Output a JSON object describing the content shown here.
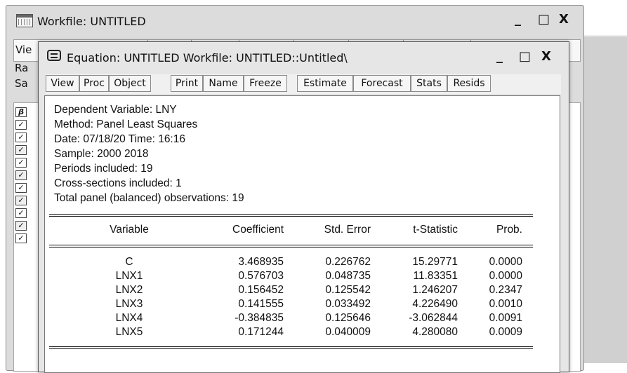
{
  "workfile": {
    "title": "Workfile: UNTITLED",
    "toolbar_partial": "Vie",
    "info_rows": [
      "Ra",
      "Sa"
    ],
    "controls": {
      "minimize": "_",
      "maximize": "□",
      "close": "X"
    }
  },
  "equation_window": {
    "title": "Equation: UNTITLED   Workfile: UNTITLED::Untitled\\",
    "controls": {
      "minimize": "_",
      "maximize": "□",
      "close": "X"
    },
    "toolbar": [
      "View",
      "Proc",
      "Object",
      "Print",
      "Name",
      "Freeze",
      "Estimate",
      "Forecast",
      "Stats",
      "Resids"
    ]
  },
  "output": {
    "header_lines": [
      "Dependent Variable: LNY",
      "Method: Panel Least Squares",
      "Date: 07/18/20   Time: 16:16",
      "Sample: 2000 2018",
      "Periods included: 19",
      "Cross-sections included: 1",
      "Total panel (balanced) observations: 19"
    ],
    "columns": [
      "Variable",
      "Coefficient",
      "Std. Error",
      "t-Statistic",
      "Prob."
    ],
    "rows": [
      [
        "C",
        "3.468935",
        "0.226762",
        "15.29771",
        "0.0000"
      ],
      [
        "LNX1",
        "0.576703",
        "0.048735",
        "11.83351",
        "0.0000"
      ],
      [
        "LNX2",
        "0.156452",
        "0.125542",
        "1.246207",
        "0.2347"
      ],
      [
        "LNX3",
        "0.141555",
        "0.033492",
        "4.226490",
        "0.0010"
      ],
      [
        "LNX4",
        "-0.384835",
        "0.125646",
        "-3.062844",
        "0.0091"
      ],
      [
        "LNX5",
        "0.171244",
        "0.040009",
        "4.280080",
        "0.0009"
      ]
    ]
  }
}
